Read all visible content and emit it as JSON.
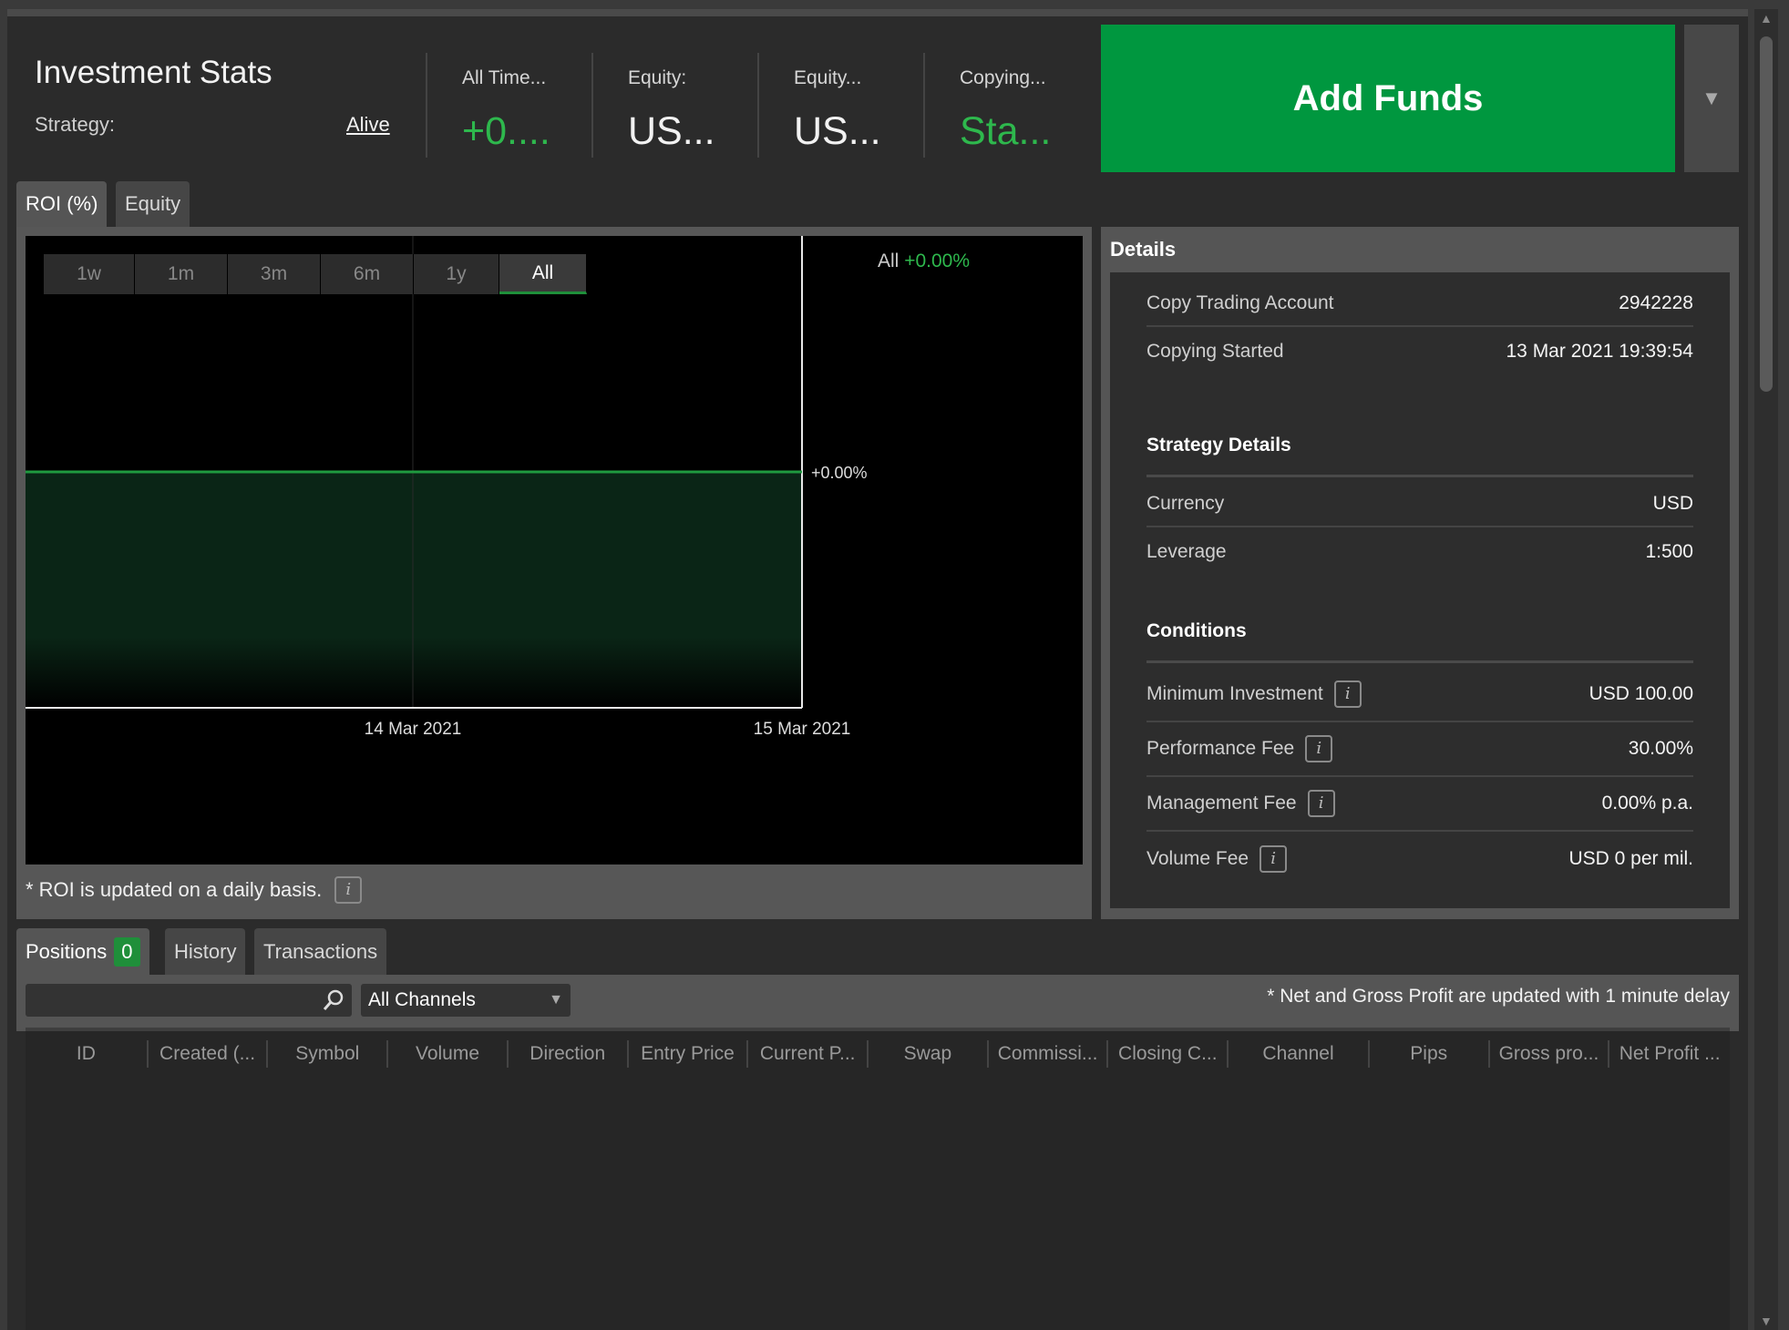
{
  "header": {
    "title": "Investment Stats",
    "strategy_label": "Strategy:",
    "strategy_value": "Alive",
    "stats": [
      {
        "label": "All Time...",
        "value": "+0...."
      },
      {
        "label": "Equity:",
        "value": "US..."
      },
      {
        "label": "Equity...",
        "value": "US..."
      },
      {
        "label": "Copying...",
        "value": "Sta..."
      }
    ],
    "add_funds_label": "Add Funds",
    "dropdown_glyph": "▼"
  },
  "chart_tabs": [
    "ROI (%)",
    "Equity"
  ],
  "chart": {
    "ranges": [
      "1w",
      "1m",
      "3m",
      "6m",
      "1y",
      "All"
    ],
    "active_range": "All",
    "summary_prefix": "All",
    "summary_value": "+0.00%",
    "line_label": "+0.00%",
    "roi_note": "* ROI is updated on a daily basis."
  },
  "chart_data": {
    "type": "area",
    "x": [
      "14 Mar 2021",
      "15 Mar 2021"
    ],
    "y": [
      0.0,
      0.0
    ],
    "x_tick_labels": [
      "14 Mar 2021",
      "15 Mar 2021"
    ],
    "right_label": "+0.00%",
    "colors": {
      "line": "#1f9a3f",
      "fill": "#0a2516"
    }
  },
  "details": {
    "title": "Details",
    "account_rows": [
      {
        "label": "Copy Trading Account",
        "value": "2942228"
      },
      {
        "label": "Copying Started",
        "value": "13 Mar 2021 19:39:54"
      }
    ],
    "strategy_title": "Strategy Details",
    "strategy_rows": [
      {
        "label": "Currency",
        "value": "USD"
      },
      {
        "label": "Leverage",
        "value": "1:500"
      }
    ],
    "conditions_title": "Conditions",
    "condition_rows": [
      {
        "label": "Minimum Investment",
        "value": "USD 100.00"
      },
      {
        "label": "Performance Fee",
        "value": "30.00%"
      },
      {
        "label": "Management Fee",
        "value": "0.00% p.a."
      },
      {
        "label": "Volume Fee",
        "value": "USD 0 per mil."
      }
    ],
    "info_glyph": "i"
  },
  "bottom_tabs": {
    "positions_label": "Positions",
    "positions_count": "0",
    "history_label": "History",
    "transactions_label": "Transactions"
  },
  "filters": {
    "search_value": "",
    "channel_value": "All Channels",
    "delay_note": "* Net and Gross Profit are updated with 1 minute delay"
  },
  "table": {
    "columns": [
      "ID",
      "Created (...",
      "Symbol",
      "Volume",
      "Direction",
      "Entry Price",
      "Current P...",
      "Swap",
      "Commissi...",
      "Closing C...",
      "Channel",
      "Pips",
      "Gross pro...",
      "Net Profit ..."
    ]
  },
  "colors": {
    "accent_green": "#00973f",
    "positive_text": "#2eb84d",
    "background": "#2b2b2b"
  }
}
